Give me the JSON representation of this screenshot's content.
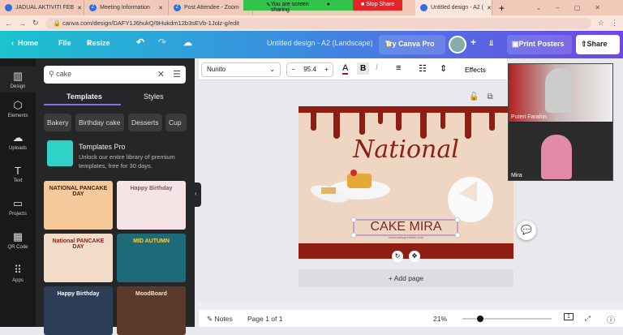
{
  "browser": {
    "tabs": [
      {
        "label": "JADUAL AKTIVITI FEB"
      },
      {
        "label": "Meeting Information"
      },
      {
        "label": "Post Attendee - Zoom"
      },
      {
        "label": "Untitled design - A2 ("
      }
    ],
    "url": "canva.com/design/DAFY1J6hukQ/9Hukdm12b3sEVb-1Jolz-g/edit",
    "share_banner": "You are screen sharing",
    "stop_share": "Stop Share"
  },
  "header": {
    "home": "Home",
    "file": "File",
    "resize": "Resize",
    "title": "Untitled design - A2 (Landscape)",
    "try_pro": "Try Canva Pro",
    "print": "Print Posters",
    "share": "Share"
  },
  "rail": [
    {
      "label": "Design",
      "icon": "▥"
    },
    {
      "label": "Elements",
      "icon": "⬡"
    },
    {
      "label": "Uploads",
      "icon": "☁"
    },
    {
      "label": "Text",
      "icon": "T"
    },
    {
      "label": "Projects",
      "icon": "▭"
    },
    {
      "label": "QR Code",
      "icon": "▦"
    },
    {
      "label": "Apps",
      "icon": "⠿"
    }
  ],
  "panel": {
    "search_value": "cake",
    "tabs": [
      "Templates",
      "Styles"
    ],
    "chips": [
      "Bakery",
      "Birthday cake",
      "Desserts",
      "Cup"
    ],
    "promo_title": "Templates Pro",
    "promo_text": "Unlock our entire library of premium templates, free for 30 days.",
    "thumbs": [
      {
        "text": "NATIONAL PANCAKE DAY",
        "bg": "#f5c99a"
      },
      {
        "text": "Happy Birthday",
        "bg": "#f6e3e6"
      },
      {
        "text": "National PANCAKE DAY",
        "bg": "#f0dcc8"
      },
      {
        "text": "MID AUTUMN",
        "bg": "#1d6a78"
      },
      {
        "text": "Happy Birthday",
        "bg": "#2c3e55"
      },
      {
        "text": "MoodBoard",
        "bg": "#5b3a2c"
      }
    ]
  },
  "toolbar": {
    "font": "Nunito",
    "size": "95.4",
    "effects": "Effects"
  },
  "design": {
    "script_title": "National",
    "main_text": "CAKE MIRA",
    "website": "www.reallygreatsite.com",
    "add_page": "+ Add page"
  },
  "video": {
    "participants": [
      "Puteri Farahin",
      "Mira"
    ]
  },
  "bottom": {
    "notes": "Notes",
    "page": "Page 1 of 1",
    "zoom": "21%",
    "zoom_fraction": 0.2,
    "page_count": "1"
  }
}
